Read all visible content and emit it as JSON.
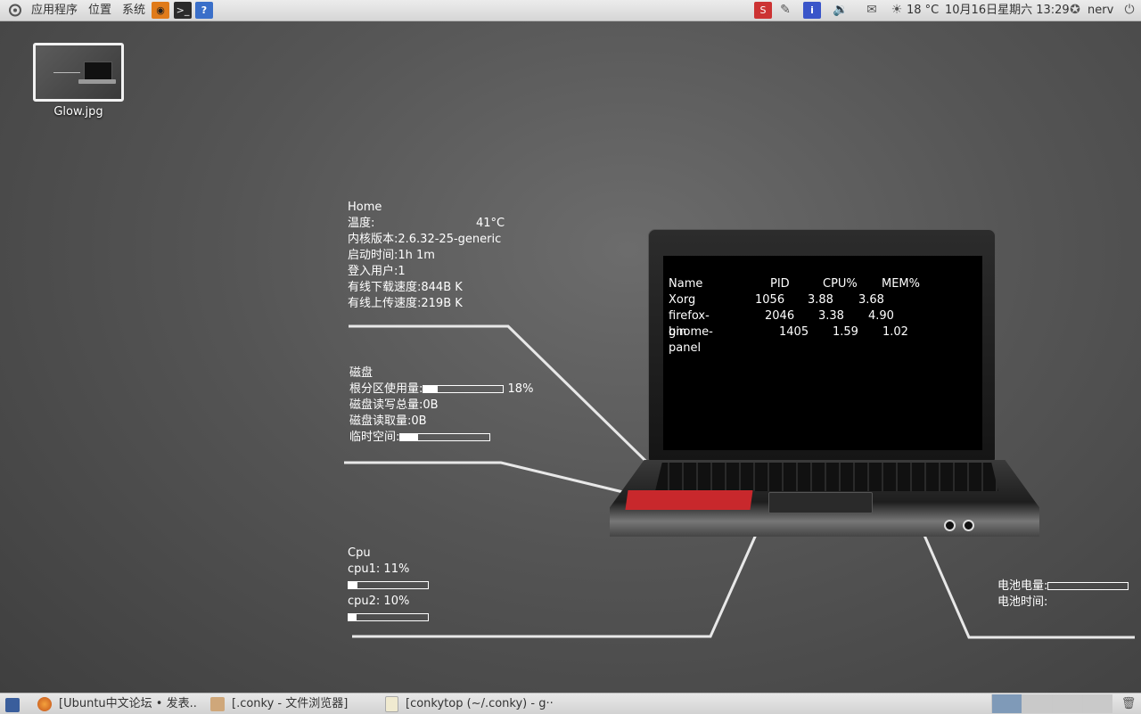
{
  "top_panel": {
    "menus": [
      "应用程序",
      "位置",
      "系统"
    ],
    "weather": "18 °C",
    "datetime": "10月16日星期六 13:29",
    "user": "nerv"
  },
  "desktop": {
    "icon_label": "Glow.jpg"
  },
  "conky_system": {
    "title": "Home",
    "temp_label": "温度:",
    "temp_value": "41°C",
    "kernel": "内核版本:2.6.32-25-generic",
    "uptime": "启动时间:1h 1m",
    "users": "登入用户:1",
    "down_speed": "有线下载速度:844B  K",
    "up_speed": "有线上传速度:219B  K"
  },
  "conky_disk": {
    "title": "磁盘",
    "root_label": "根分区使用量:",
    "root_pct": "18%",
    "root_fill": 0.18,
    "io_total": "磁盘读写总量:0B",
    "read": "磁盘读取量:0B",
    "tmp_label": "临时空间:",
    "tmp_fill": 0.2
  },
  "conky_cpu": {
    "title": "Cpu",
    "cpu1": "cpu1:   11%",
    "cpu1_fill": 0.11,
    "cpu2": "cpu2:   10%",
    "cpu2_fill": 0.1
  },
  "conky_battery": {
    "charge_label": "电池电量:",
    "charge_fill": 0.0,
    "time_label": "电池时间:"
  },
  "processes": {
    "headers": [
      "Name",
      "PID",
      "CPU%",
      "MEM%"
    ],
    "rows": [
      {
        "name": "Xorg",
        "pid": "1056",
        "cpu": "3.88",
        "mem": "3.68"
      },
      {
        "name": "firefox-bin",
        "pid": "2046",
        "cpu": "3.38",
        "mem": "4.90"
      },
      {
        "name": "gnome-panel",
        "pid": "1405",
        "cpu": "1.59",
        "mem": "1.02"
      }
    ]
  },
  "taskbar": {
    "tasks": [
      "[Ubuntu中文论坛 • 发表...",
      "[.conky - 文件浏览器]",
      "[conkytop (~/.conky) - g···"
    ]
  }
}
